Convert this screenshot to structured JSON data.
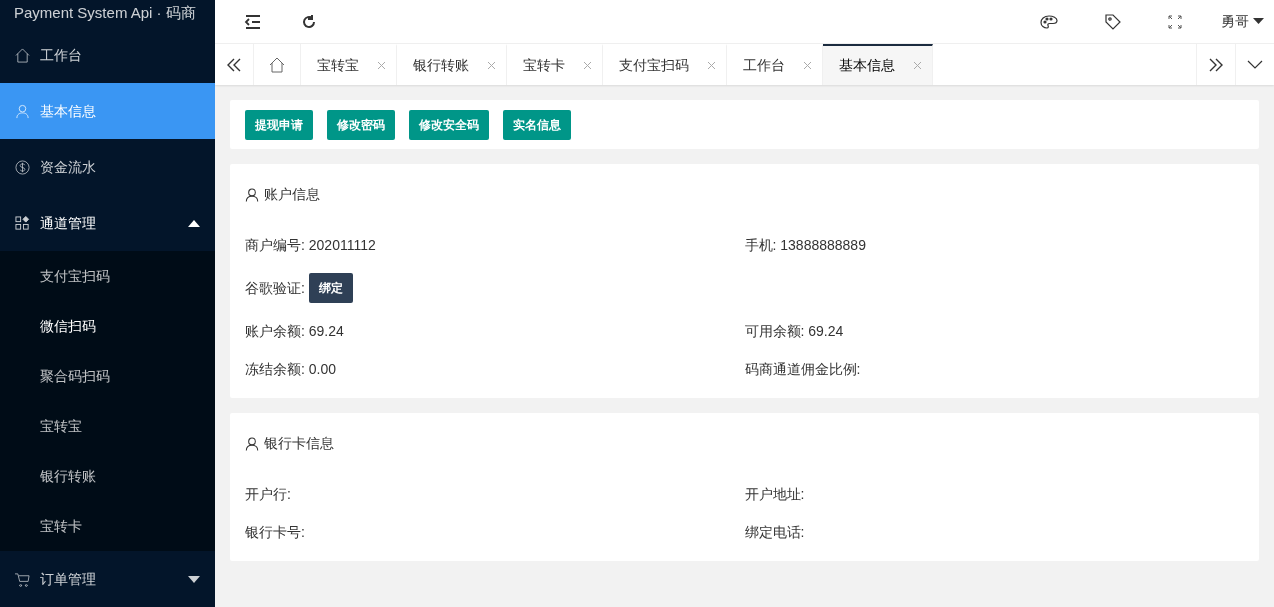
{
  "sidebar": {
    "title": "Payment System Api · 码商",
    "items": [
      {
        "kind": "home",
        "label": "工作台",
        "selected": false
      },
      {
        "kind": "user",
        "label": "基本信息",
        "selected": true
      },
      {
        "kind": "dollar",
        "label": "资金流水",
        "selected": false
      },
      {
        "kind": "grid",
        "label": "通道管理",
        "selected": false,
        "expanded": true,
        "children": [
          {
            "label": "支付宝扫码",
            "selected": false
          },
          {
            "label": "微信扫码",
            "selected": true
          },
          {
            "label": "聚合码扫码",
            "selected": false
          },
          {
            "label": "宝转宝",
            "selected": false
          },
          {
            "label": "银行转账",
            "selected": false
          },
          {
            "label": "宝转卡",
            "selected": false
          }
        ]
      },
      {
        "kind": "cart",
        "label": "订单管理",
        "selected": false,
        "expanded": false
      }
    ]
  },
  "header": {
    "user": "勇哥"
  },
  "tabs": [
    {
      "label": "宝转宝",
      "selected": false
    },
    {
      "label": "银行转账",
      "selected": false
    },
    {
      "label": "宝转卡",
      "selected": false
    },
    {
      "label": "支付宝扫码",
      "selected": false
    },
    {
      "label": "工作台",
      "selected": false
    },
    {
      "label": "基本信息",
      "selected": true
    }
  ],
  "actions": [
    "提现申请",
    "修改密码",
    "修改安全码",
    "实名信息"
  ],
  "sections": [
    {
      "title": "账户信息",
      "rows": [
        [
          {
            "kind": "text",
            "text": "商户编号: 202011112"
          },
          {
            "kind": "text",
            "text": "手机: 13888888889"
          }
        ],
        [
          {
            "kind": "button",
            "text": "谷歌验证:",
            "button": "绑定"
          }
        ],
        [
          {
            "kind": "text",
            "text": "账户余额: 69.24"
          },
          {
            "kind": "text",
            "text": "可用余额: 69.24"
          }
        ],
        [
          {
            "kind": "text",
            "text": "冻结余额: 0.00"
          },
          {
            "kind": "text",
            "text": "码商通道佣金比例:"
          }
        ]
      ]
    },
    {
      "title": "银行卡信息",
      "rows": [
        [
          {
            "kind": "text",
            "text": "开户行:"
          },
          {
            "kind": "text",
            "text": "开户地址:"
          }
        ],
        [
          {
            "kind": "text",
            "text": "银行卡号:"
          },
          {
            "kind": "text",
            "text": "绑定电话:"
          }
        ]
      ]
    }
  ]
}
